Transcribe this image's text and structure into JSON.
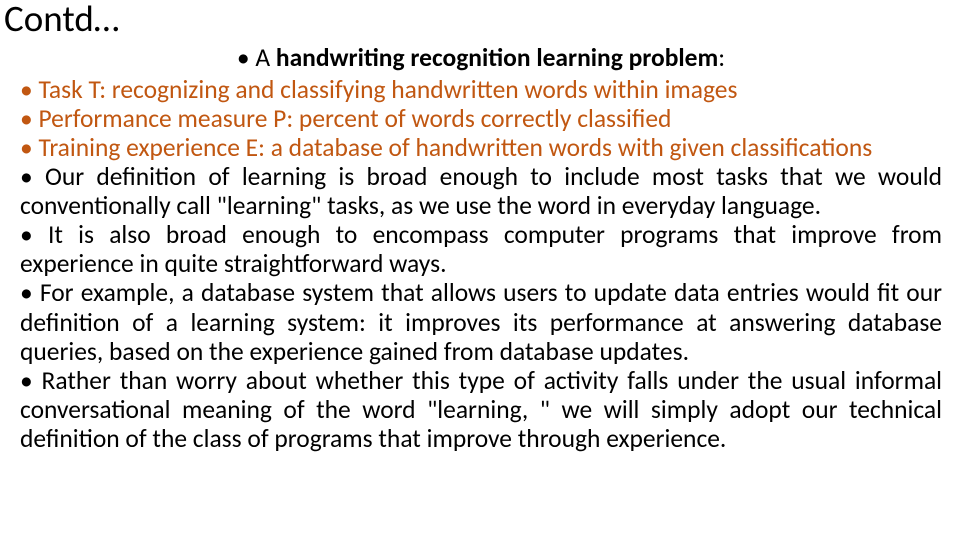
{
  "title": "Contd…",
  "heading": {
    "bullet": "•",
    "prefix": "A ",
    "bold": "handwriting recognition learning problem",
    "suffix": ":"
  },
  "bullets": [
    {
      "text": "Task T: recognizing and classifying handwritten words within images",
      "color": "colored",
      "justify": false
    },
    {
      "text": "Performance measure P: percent of words correctly classified",
      "color": "colored",
      "justify": false
    },
    {
      "text": "Training experience E: a database of handwritten words with given classifications",
      "color": "colored",
      "justify": false
    },
    {
      "text": "Our definition of learning is broad enough to include most tasks that we would conventionally call \"learning\" tasks, as we use the word in everyday language.",
      "color": "black",
      "justify": true
    },
    {
      "text": "It is also broad enough to encompass computer programs that improve from experience in quite straightforward ways.",
      "color": "black",
      "justify": true
    },
    {
      "text": "For example, a database system that allows users to update data entries would fit our definition of a learning system: it improves its performance at answering database queries, based on the experience gained from database updates.",
      "color": "black",
      "justify": true
    },
    {
      "text": "Rather than worry about whether this type of activity falls under the usual informal conversational meaning of the word \"learning, \" we will simply adopt our technical definition of the class of programs that improve through experience.",
      "color": "black",
      "justify": true
    }
  ]
}
